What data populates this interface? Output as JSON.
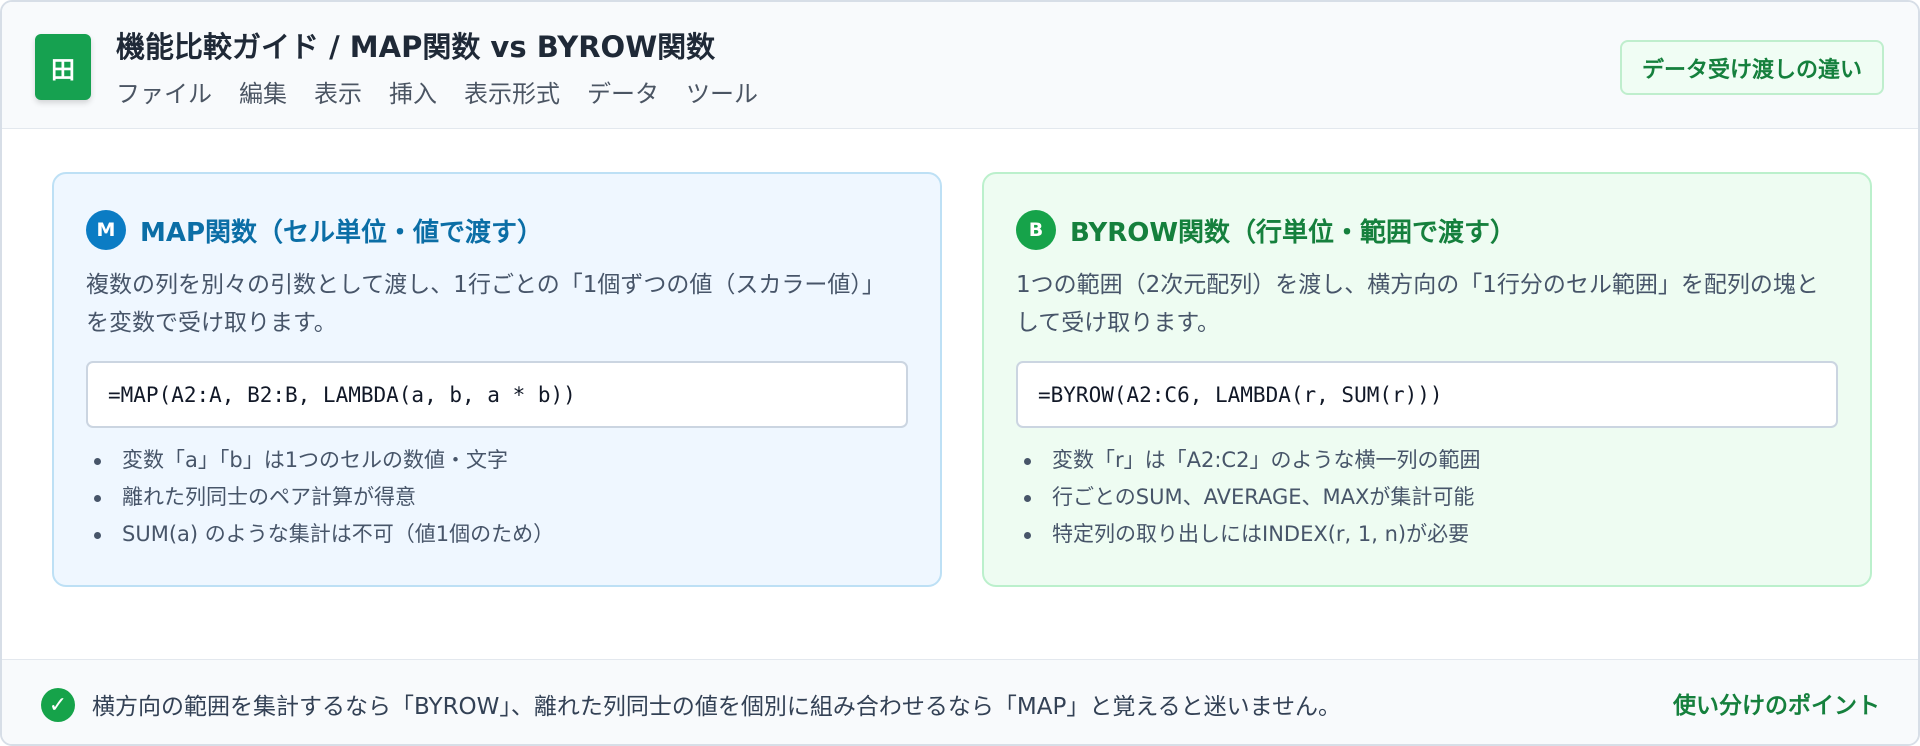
{
  "header": {
    "app_icon_glyph": "田",
    "title": "機能比較ガイド / MAP関数 vs BYROW関数",
    "menu": [
      "ファイル",
      "編集",
      "表示",
      "挿入",
      "表示形式",
      "データ",
      "ツール"
    ],
    "badge": "データ受け渡しの違い"
  },
  "cards": {
    "map": {
      "badge": "M",
      "title": "MAP関数（セル単位・値で渡す）",
      "description": "複数の列を別々の引数として渡し、1行ごとの「1個ずつの値（スカラー値）」を変数で受け取ります。",
      "formula": "=MAP(A2:A, B2:B, LAMBDA(a, b, a * b))",
      "bullets": [
        "変数「a」「b」は1つのセルの数値・文字",
        "離れた列同士のペア計算が得意",
        "SUM(a) のような集計は不可（値1個のため）"
      ],
      "accent_color": "#0b7cc4"
    },
    "byrow": {
      "badge": "B",
      "title": "BYROW関数（行単位・範囲で渡す）",
      "description": "1つの範囲（2次元配列）を渡し、横方向の「1行分のセル範囲」を配列の塊として受け取ります。",
      "formula": "=BYROW(A2:C6, LAMBDA(r, SUM(r)))",
      "bullets": [
        "変数「r」は「A2:C2」のような横一列の範囲",
        "行ごとのSUM、AVERAGE、MAXが集計可能",
        "特定列の取り出しにはINDEX(r, 1, n)が必要"
      ],
      "accent_color": "#16a34a"
    }
  },
  "footer": {
    "icon": "check-icon",
    "text": "横方向の範囲を集計するなら「BYROW」、離れた列同士の値を個別に組み合わせるなら「MAP」と覚えると迷いません。",
    "label": "使い分けのポイント"
  }
}
